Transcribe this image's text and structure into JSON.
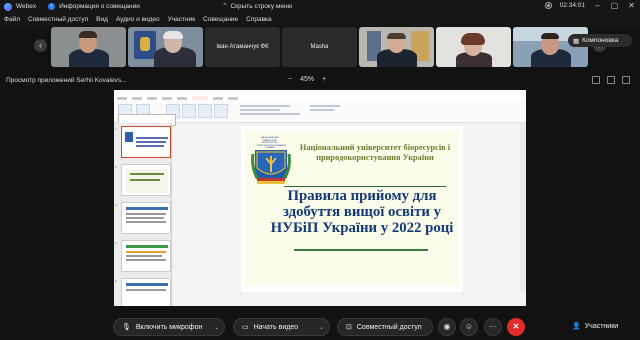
{
  "titlebar": {
    "app_name": "Webex",
    "meeting_info": "Информация о совещании",
    "hide_menu": "Скрыть строку меню",
    "time": "02:34:01"
  },
  "menu": [
    "Файл",
    "Совместный доступ",
    "Вид",
    "Аудио и видео",
    "Участник",
    "Совещание",
    "Справка"
  ],
  "participants_strip": {
    "tiles": [
      {
        "name": ""
      },
      {
        "name": ""
      },
      {
        "name": "Іван Атаманчук ФК"
      },
      {
        "name": "Masha"
      },
      {
        "name": ""
      },
      {
        "name": ""
      },
      {
        "name": ""
      }
    ],
    "layout_label": "Компоновка"
  },
  "share_bar": {
    "title": "Просмотр приложений Serhii Kovalevs...",
    "zoom_minus": "−",
    "zoom_level": "45%",
    "zoom_plus": "+"
  },
  "slide": {
    "emblem_text": "НАЦІОНАЛЬНИЙ УНІВЕРСИТЕТ БІОРЕСУРСІВ І ПРИРОДОКОРИСТУВАННЯ УКРАЇНИ",
    "university": "Національний університет біоресурсів і природокористування України",
    "title": "Правила прийому для здобуття вищої освіти у НУБіП України у 2022 році"
  },
  "controls": {
    "mic_label": "Включить микрофон",
    "video_label": "Начать видео",
    "share_label": "Совместный доступ",
    "participants_label": "Участники"
  },
  "colors": {
    "end_button": "#e02b2b",
    "slide_title": "#143a78",
    "slide_university": "#6b7f32"
  }
}
